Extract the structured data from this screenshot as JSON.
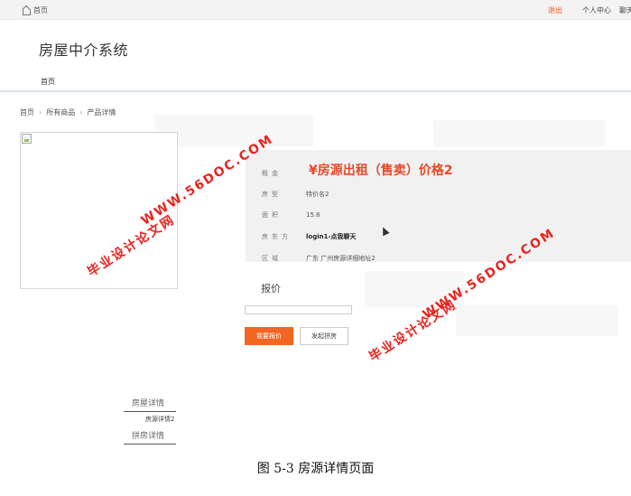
{
  "topbar": {
    "home": "首页",
    "logout": "退出",
    "personal_center": "个人中心",
    "chat": "聊天"
  },
  "header": {
    "site_title": "房屋中介系统",
    "nav_home": "首页"
  },
  "breadcrumb": [
    "首页",
    "所有商品",
    "产品详情"
  ],
  "product": {
    "price_title": "¥房源出租（售卖）价格2",
    "rows": [
      {
        "label": "租金",
        "value": ""
      },
      {
        "label": "房型",
        "value": "特价名2"
      },
      {
        "label": "面积",
        "value": "15.6"
      },
      {
        "label": "房东方",
        "value": "login1-点我聊天"
      },
      {
        "label": "区域",
        "value": "广东 广州房源详细地址2"
      }
    ]
  },
  "quote": {
    "label": "报价",
    "input_value": "",
    "submit_label": "我要报价",
    "group_label": "发起拼房"
  },
  "tabs": {
    "detail": "房屋详情",
    "detail_content": "房源详情2",
    "group": "拼房详情"
  },
  "watermarks": {
    "line1": "WWW.56DOC.COM",
    "line2": "毕业设计论文网",
    "line3": "WWW.56DOC.COM",
    "line4": "毕业设计论文网"
  },
  "caption": "图 5-3 房源详情页面",
  "colors": {
    "accent": "#f26522",
    "price": "#e8492a",
    "watermark": "#e8231e"
  }
}
